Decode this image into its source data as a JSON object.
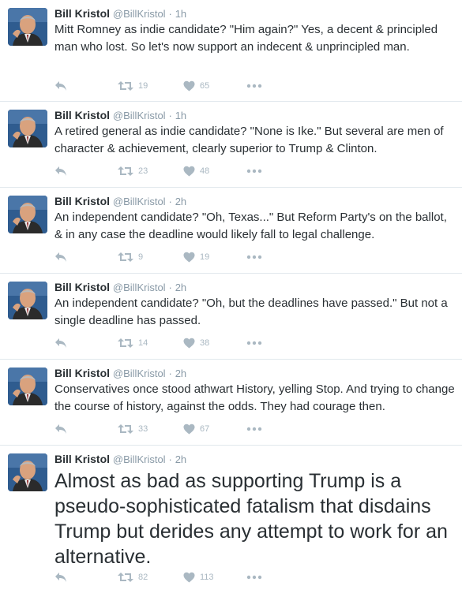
{
  "colors": {
    "action_gray": "#aab8c2",
    "meta_gray": "#8899a6",
    "text": "#292f33",
    "divider": "#e1e8ed"
  },
  "icons": {
    "reply": "reply-arrow-icon",
    "retweet": "retweet-icon",
    "like": "heart-icon",
    "more": "ellipsis-icon"
  },
  "tweets": [
    {
      "name": "Bill Kristol",
      "handle": "@BillKristol",
      "dot": "·",
      "time": "1h",
      "text": "Mitt Romney as indie candidate? \"Him again?\" Yes, a decent & principled man who lost. So let's now support an indecent & unprincipled man.",
      "retweets": "19",
      "likes": "65"
    },
    {
      "name": "Bill Kristol",
      "handle": "@BillKristol",
      "dot": "·",
      "time": "1h",
      "text": "A retired general as indie candidate? \"None is Ike.\" But several are men of character & achievement, clearly superior to Trump & Clinton.",
      "retweets": "23",
      "likes": "48"
    },
    {
      "name": "Bill Kristol",
      "handle": "@BillKristol",
      "dot": "·",
      "time": "2h",
      "text": "An independent candidate? \"Oh, Texas...\" But Reform Party's on the ballot, & in any case the deadline would likely fall to legal challenge.",
      "retweets": "9",
      "likes": "19"
    },
    {
      "name": "Bill Kristol",
      "handle": "@BillKristol",
      "dot": "·",
      "time": "2h",
      "text": "An independent candidate? \"Oh, but the deadlines have passed.\" But not a single deadline has passed.",
      "retweets": "14",
      "likes": "38"
    },
    {
      "name": "Bill Kristol",
      "handle": "@BillKristol",
      "dot": "·",
      "time": "2h",
      "text": "Conservatives once stood athwart History, yelling Stop. And trying to change the course of history, against the odds. They had courage then.",
      "retweets": "33",
      "likes": "67"
    },
    {
      "name": "Bill Kristol",
      "handle": "@BillKristol",
      "dot": "·",
      "time": "2h",
      "text": "Almost as bad as supporting Trump is a pseudo-sophisticated fatalism that disdains Trump but derides any attempt to work for an alternative.",
      "retweets": "82",
      "likes": "113"
    }
  ]
}
